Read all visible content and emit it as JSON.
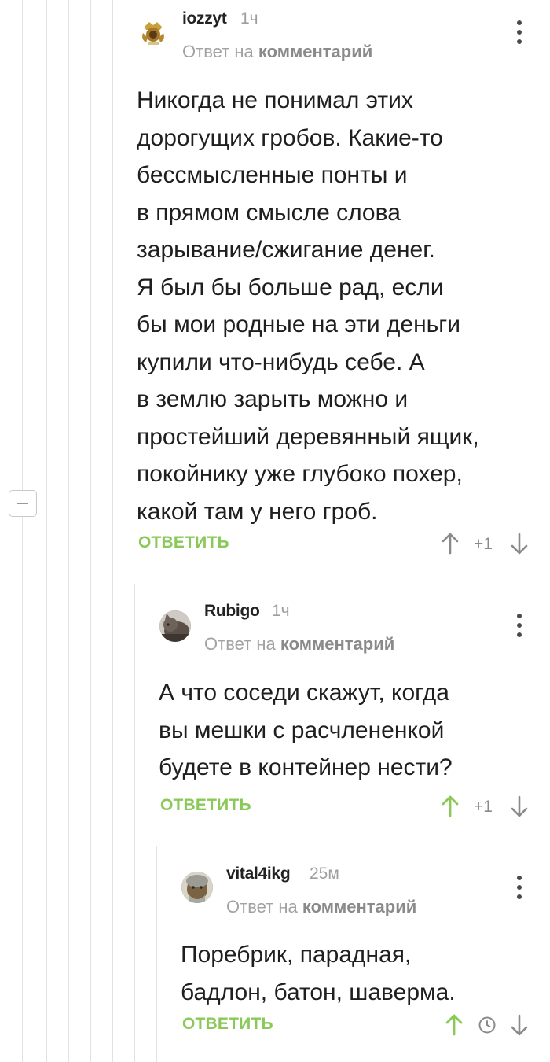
{
  "comments": [
    {
      "author": "iozzyt",
      "time": "1ч",
      "reply_prefix": "Ответ на",
      "reply_link": "комментарий",
      "text": "Никогда не понимал этих\nдорогущих гробов. Какие-то\nбессмысленные понты и\nв прямом смысле слова\nзарывание/сжигание денег.\nЯ был бы больше рад, если\nбы мои родные на эти деньги\nкупили что-нибудь себе. А\nв землю зарыть можно и\nпростейший деревянный ящик,\nпокойнику уже глубоко похер,\nкакой там у него гроб.",
      "reply_label": "ОТВЕТИТЬ",
      "rating": "+1",
      "upvoted": false
    },
    {
      "author": "Rubigo",
      "time": "1ч",
      "reply_prefix": "Ответ на",
      "reply_link": "комментарий",
      "text": "А что соседи скажут, когда\nвы мешки с расчлененкой\nбудете в контейнер нести?",
      "reply_label": "ОТВЕТИТЬ",
      "rating": "+1",
      "upvoted": true
    },
    {
      "author": "vital4ikg",
      "time": "25м",
      "reply_prefix": "Ответ на",
      "reply_link": "комментарий",
      "text": "Поребрик, парадная,\nбадлон, батон, шаверма.",
      "reply_label": "ОТВЕТИТЬ",
      "rating_hidden": true,
      "upvoted": true
    }
  ],
  "colors": {
    "accent_green": "#8ac858",
    "text": "#1f1f1f",
    "muted": "#a2a2a2",
    "thread_line": "#e2e2e2"
  },
  "icons": {
    "collapse": "minus-icon",
    "menu": "kebab-menu-icon",
    "upvote": "arrow-up-icon",
    "downvote": "arrow-down-icon",
    "hidden_rating": "clock-icon"
  }
}
